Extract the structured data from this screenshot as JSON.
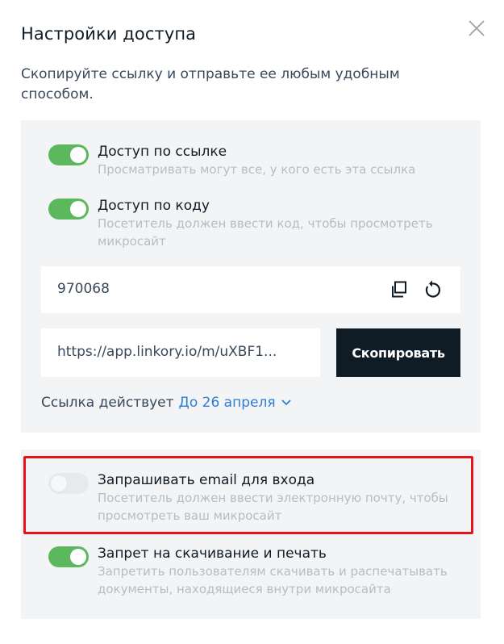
{
  "dialog": {
    "title": "Настройки доступа",
    "subtitle": "Скопируйте ссылку и отправьте ее любым удобным способом."
  },
  "access_link": {
    "title": "Доступ по ссылке",
    "description": "Просматривать могут все, у кого есть эта ссылка",
    "enabled": true
  },
  "access_code": {
    "title": "Доступ по коду",
    "description": "Посетитель должен ввести код, чтобы просмотреть микросайт",
    "enabled": true,
    "code": "970068"
  },
  "link": {
    "value": "https://app.linkory.io/m/uXBF1...",
    "copy_label": "Скопировать",
    "validity_label": "Ссылка действует",
    "validity_value": "До 26 апреля"
  },
  "request_email": {
    "title": "Запрашивать email для входа",
    "description": "Посетитель должен ввести электронную почту, чтобы просмотреть ваш микросайт",
    "enabled": false
  },
  "download_ban": {
    "title": "Запрет на скачивание и печать",
    "description": "Запретить пользователям скачивать и распечатывать документы, находящиеся внутри микросайта",
    "enabled": true
  },
  "colors": {
    "toggle_on": "#5cb85c",
    "toggle_off": "#e8e9ec",
    "primary_button": "#0f1b25",
    "link_accent": "#2f7dd6",
    "highlight": "#e5121b"
  },
  "icons": [
    "close-icon",
    "copy-icon",
    "refresh-icon",
    "chevron-down-icon"
  ]
}
